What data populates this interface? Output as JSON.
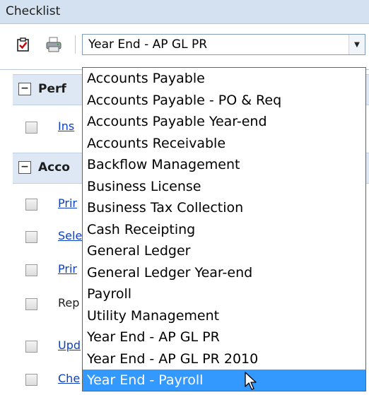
{
  "panel": {
    "title": "Checklist"
  },
  "toolbar": {
    "checklist_icon": "checklist-icon",
    "print_icon": "printer-icon",
    "combo_value": "Year End - AP GL PR"
  },
  "groups": [
    {
      "title": "Perf"
    },
    {
      "title": "Acco"
    }
  ],
  "rows": [
    {
      "text": "Ins",
      "type": "link"
    },
    {
      "text": "Prir",
      "type": "link"
    },
    {
      "text": "Sele",
      "type": "link"
    },
    {
      "text": "Prir",
      "type": "link"
    },
    {
      "text": "Rep",
      "type": "plain"
    },
    {
      "text": "Upd",
      "type": "link"
    },
    {
      "text": "Che",
      "type": "link"
    }
  ],
  "dropdown": {
    "options": [
      "Accounts Payable",
      "Accounts Payable - PO & Req",
      "Accounts Payable Year-end",
      "Accounts Receivable",
      "Backflow Management",
      "Business License",
      "Business Tax Collection",
      "Cash Receipting",
      "General Ledger",
      "General Ledger Year-end",
      "Payroll",
      "Utility Management",
      "Year End - AP GL PR",
      "Year End - AP GL PR 2010",
      "Year End - Payroll"
    ],
    "highlighted": "Year End - Payroll"
  },
  "colors": {
    "title_bar": "#d3e1f1",
    "group_header": "#dde8f4",
    "highlight": "#3399ff",
    "link": "#0b3fc4"
  }
}
